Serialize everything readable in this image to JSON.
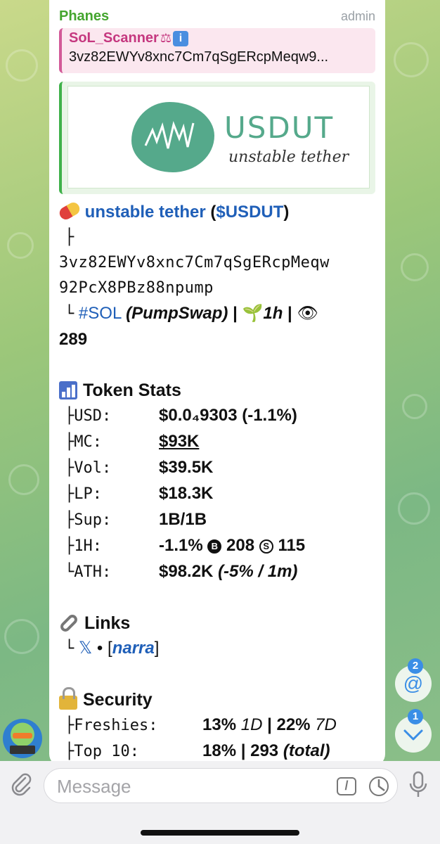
{
  "message": {
    "sender": "Phanes",
    "role": "admin",
    "reply": {
      "name": "SoL_Scanner",
      "text": "3vz82EWYv8xnc7Cm7qSgERcpMeqw9..."
    },
    "preview": {
      "logo_title": "USDUT",
      "logo_subtitle": "unstable tether"
    },
    "token": {
      "name": "unstable tether",
      "ticker_open": " (",
      "ticker": "$USDUT",
      "ticker_close": ")",
      "branch": "├",
      "address_line1": "3vz82EWYv8xnc7Cm7qSgERcpMeqw",
      "address_line2": "92PcX8PBz88npump",
      "leaf": "└",
      "chain_tag": "#SOL",
      "dex": "(PumpSwap)",
      "sep1": " | ",
      "age": "1h",
      "sep2": " | ",
      "views": "289"
    },
    "stats": {
      "heading": "Token Stats",
      "rows": [
        {
          "label": "├USD:",
          "value": "$0.0₄9303 (-1.1%)"
        },
        {
          "label": "├MC:",
          "value": "$93K"
        },
        {
          "label": "├Vol:",
          "value": "$39.5K"
        },
        {
          "label": "├LP:",
          "value": "$18.3K"
        },
        {
          "label": "├Sup:",
          "value": "1B/1B"
        },
        {
          "label": "├1H:",
          "value_a": "-1.1%",
          "value_b": "208",
          "value_c": "115"
        },
        {
          "label": "└ATH:",
          "value_a": "$98.2K",
          "value_b": "(-5% / 1m)"
        }
      ]
    },
    "links": {
      "heading": "Links",
      "leaf": "└",
      "x": "𝕏",
      "dot": " • ",
      "bracket_open": "[",
      "narra": "narra",
      "bracket_close": "]"
    },
    "security": {
      "heading": "Security",
      "rows": [
        {
          "label": "├Freshies:",
          "value_a": "13%",
          "value_b": "1D",
          "sep": " | ",
          "value_c": "22%",
          "value_d": "7D"
        },
        {
          "label": "├Top 10:",
          "value_a": "18%",
          "sep": " | ",
          "value_c": "293",
          "value_d": "(total)"
        }
      ]
    }
  },
  "fabs": {
    "mentions_count": "2",
    "mentions_symbol": "@",
    "down_count": "1"
  },
  "composer": {
    "placeholder": "Message",
    "command_symbol": "/"
  }
}
